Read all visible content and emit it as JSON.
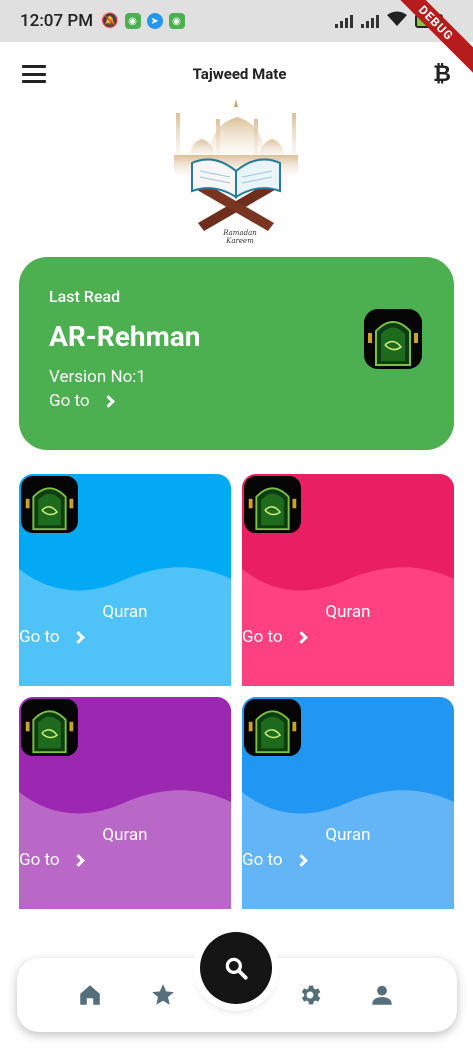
{
  "status_bar": {
    "time": "12:07 PM",
    "battery": "78"
  },
  "debug_banner": "DEBUG",
  "app_bar": {
    "title": "Tajweed Mate",
    "menu_icon": "menu-icon",
    "right_icon": "bitcoin-icon"
  },
  "logo": {
    "caption_line1": "Ramadan",
    "caption_line2": "Kareem"
  },
  "last_read": {
    "label": "Last Read",
    "name": "AR-Rehman",
    "version": "Version No:1",
    "goto": "Go to",
    "color": "#4caf50"
  },
  "cards": [
    {
      "title": "Quran",
      "goto": "Go to",
      "top_color": "#03a9f4",
      "bottom_color": "#4fc3f7"
    },
    {
      "title": "Quran",
      "goto": "Go to",
      "top_color": "#e91e63",
      "bottom_color": "#ff4081"
    },
    {
      "title": "Quran",
      "goto": "Go to",
      "top_color": "#9c27b0",
      "bottom_color": "#ba68c8"
    },
    {
      "title": "Quran",
      "goto": "Go to",
      "top_color": "#2196f3",
      "bottom_color": "#64b5f6"
    }
  ],
  "bottom_nav": {
    "items": [
      "home-icon",
      "star-icon",
      "search-icon",
      "settings-icon",
      "person-icon"
    ],
    "icon_color": "#546e7a"
  }
}
